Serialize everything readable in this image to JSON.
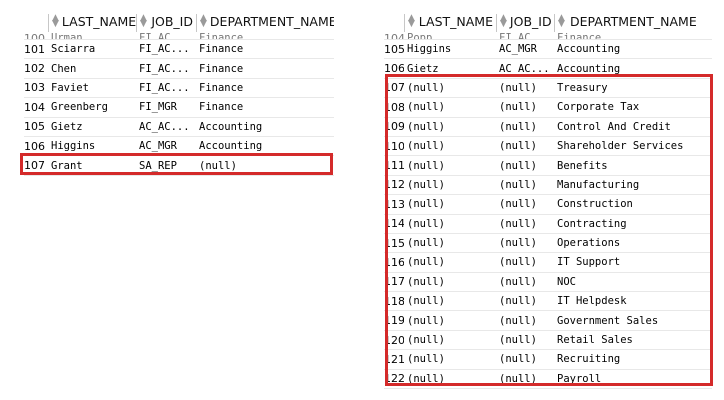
{
  "highlight_color": "#d42a2a",
  "icons": {
    "sort": "sort-arrows-icon"
  },
  "left_grid": {
    "columns": [
      "LAST_NAME",
      "JOB_ID",
      "DEPARTMENT_NAME"
    ],
    "partial_row": {
      "num": "100",
      "last_name": "Urman",
      "job_id": "FI_AC...",
      "department_name": "Finance"
    },
    "rows": [
      {
        "num": "101",
        "last_name": "Sciarra",
        "job_id": "FI_AC...",
        "department_name": "Finance"
      },
      {
        "num": "102",
        "last_name": "Chen",
        "job_id": "FI_AC...",
        "department_name": "Finance"
      },
      {
        "num": "103",
        "last_name": "Faviet",
        "job_id": "FI_AC...",
        "department_name": "Finance"
      },
      {
        "num": "104",
        "last_name": "Greenberg",
        "job_id": "FI_MGR",
        "department_name": "Finance"
      },
      {
        "num": "105",
        "last_name": "Gietz",
        "job_id": "AC_AC...",
        "department_name": "Accounting"
      },
      {
        "num": "106",
        "last_name": "Higgins",
        "job_id": "AC_MGR",
        "department_name": "Accounting"
      },
      {
        "num": "107",
        "last_name": "Grant",
        "job_id": "SA_REP",
        "department_name": "(null)"
      }
    ]
  },
  "right_grid": {
    "columns": [
      "LAST_NAME",
      "JOB_ID",
      "DEPARTMENT_NAME"
    ],
    "partial_row": {
      "num": "104",
      "last_name": "Popp",
      "job_id": "FI_AC...",
      "department_name": "Finance"
    },
    "rows": [
      {
        "num": "105",
        "last_name": "Higgins",
        "job_id": "AC_MGR",
        "department_name": "Accounting"
      },
      {
        "num": "106",
        "last_name": "Gietz",
        "job_id": "AC_AC...",
        "department_name": "Accounting"
      },
      {
        "num": "107",
        "last_name": "(null)",
        "job_id": "(null)",
        "department_name": "Treasury"
      },
      {
        "num": "108",
        "last_name": "(null)",
        "job_id": "(null)",
        "department_name": "Corporate Tax"
      },
      {
        "num": "109",
        "last_name": "(null)",
        "job_id": "(null)",
        "department_name": "Control And Credit"
      },
      {
        "num": "110",
        "last_name": "(null)",
        "job_id": "(null)",
        "department_name": "Shareholder Services"
      },
      {
        "num": "111",
        "last_name": "(null)",
        "job_id": "(null)",
        "department_name": "Benefits"
      },
      {
        "num": "112",
        "last_name": "(null)",
        "job_id": "(null)",
        "department_name": "Manufacturing"
      },
      {
        "num": "113",
        "last_name": "(null)",
        "job_id": "(null)",
        "department_name": "Construction"
      },
      {
        "num": "114",
        "last_name": "(null)",
        "job_id": "(null)",
        "department_name": "Contracting"
      },
      {
        "num": "115",
        "last_name": "(null)",
        "job_id": "(null)",
        "department_name": "Operations"
      },
      {
        "num": "116",
        "last_name": "(null)",
        "job_id": "(null)",
        "department_name": "IT Support"
      },
      {
        "num": "117",
        "last_name": "(null)",
        "job_id": "(null)",
        "department_name": "NOC"
      },
      {
        "num": "118",
        "last_name": "(null)",
        "job_id": "(null)",
        "department_name": "IT Helpdesk"
      },
      {
        "num": "119",
        "last_name": "(null)",
        "job_id": "(null)",
        "department_name": "Government Sales"
      },
      {
        "num": "120",
        "last_name": "(null)",
        "job_id": "(null)",
        "department_name": "Retail Sales"
      },
      {
        "num": "121",
        "last_name": "(null)",
        "job_id": "(null)",
        "department_name": "Recruiting"
      },
      {
        "num": "122",
        "last_name": "(null)",
        "job_id": "(null)",
        "department_name": "Payroll"
      }
    ]
  }
}
